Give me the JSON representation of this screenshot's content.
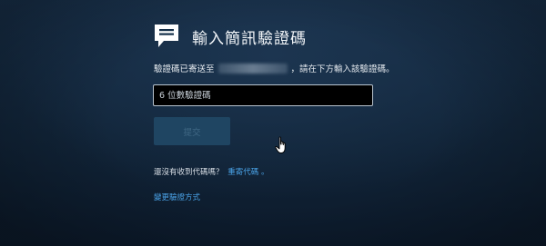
{
  "header": {
    "icon": "chat-bubble-icon",
    "title": "輸入簡訊驗證碼"
  },
  "instruction": {
    "prefix": "驗證碼已寄送至",
    "suffix": "，請在下方輸入該驗證碼。"
  },
  "code_input": {
    "value": "",
    "placeholder": "6 位數驗證碼"
  },
  "submit": {
    "label": "提交"
  },
  "resend": {
    "question": "還沒有收到代碼嗎？",
    "link_label": "重寄代碼",
    "link_suffix": "。"
  },
  "change_method": {
    "label": "變更驗證方式"
  },
  "colors": {
    "link": "#4aa3e8",
    "button_disabled": "#1f4562",
    "background": "#142a40"
  }
}
